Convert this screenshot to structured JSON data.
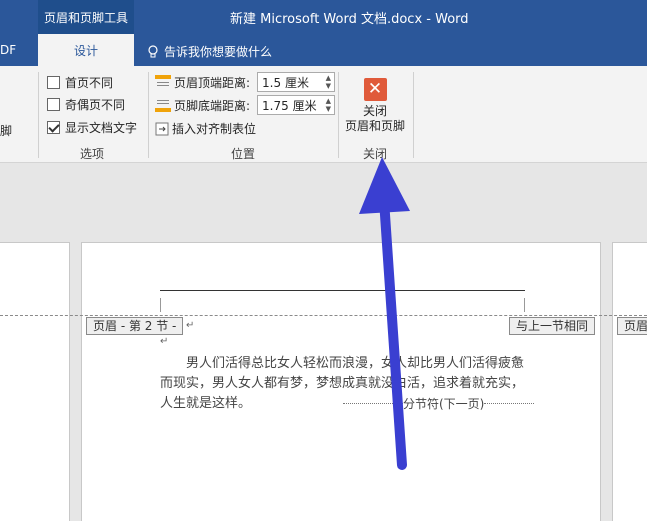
{
  "titlebar": {
    "tool_tab": "页眉和页脚工具",
    "window_title": "新建 Microsoft Word 文档.docx  -  Word"
  },
  "tabs": {
    "partial": "PDF",
    "design": "设计",
    "tell_me": "告诉我你想要做什么"
  },
  "ribbon": {
    "partial_left_label": "页脚",
    "options_group": {
      "label": "选项",
      "items": [
        {
          "label": "首页不同",
          "checked": false
        },
        {
          "label": "奇偶页不同",
          "checked": false
        },
        {
          "label": "显示文档文字",
          "checked": true
        }
      ]
    },
    "position_group": {
      "label": "位置",
      "header_top_label": "页眉顶端距离:",
      "header_top_value": "1.5 厘米",
      "footer_bottom_label": "页脚底端距离:",
      "footer_bottom_value": "1.75 厘米",
      "insert_tab_label": "插入对齐制表位"
    },
    "close_group": {
      "label": "关闭",
      "button_line1": "关闭",
      "button_line2": "页眉和页脚"
    }
  },
  "document": {
    "header_tag": "页眉 - 第 2 节 -",
    "same_as_previous": "与上一节相同",
    "right_page_tag": "页眉",
    "paragraph": "男人们活得总比女人轻松而浪漫，女人却比男人们活得疲惫而现实，男人女人都有梦，梦想成真就没白活，追求着就充实，人生就是这样。",
    "section_break": "分节符(下一页)"
  },
  "colors": {
    "accent": "#2b579a",
    "arrow": "#3a3fd1",
    "close_icon": "#e05a3a"
  }
}
